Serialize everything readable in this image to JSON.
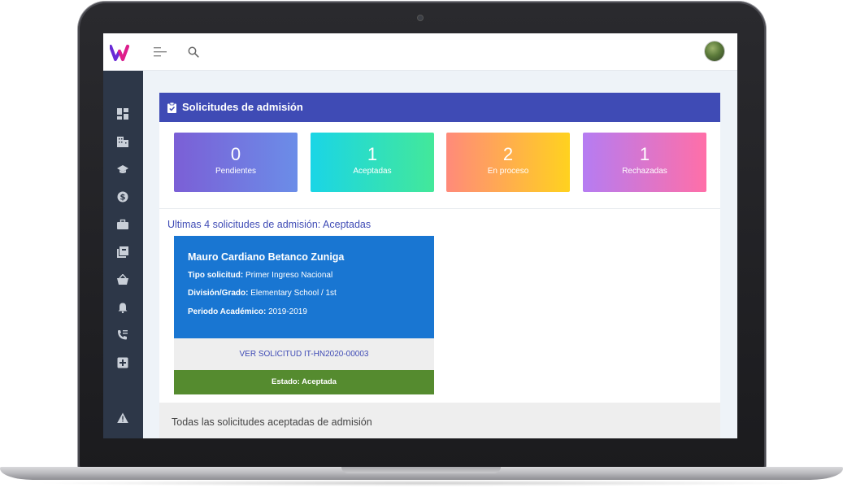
{
  "header": {
    "icons": [
      "logo-icon",
      "menu-icon",
      "search-icon",
      "avatar"
    ]
  },
  "sidebar": {
    "items": [
      {
        "icon": "dashboard-icon"
      },
      {
        "icon": "building-icon"
      },
      {
        "icon": "graduation-cap-icon"
      },
      {
        "icon": "dollar-icon"
      },
      {
        "icon": "briefcase-icon"
      },
      {
        "icon": "library-icon"
      },
      {
        "icon": "basket-icon"
      },
      {
        "icon": "bell-icon"
      },
      {
        "icon": "phone-list-icon"
      },
      {
        "icon": "medical-box-icon"
      },
      {
        "icon": "warning-icon"
      }
    ]
  },
  "panel": {
    "title": "Solicitudes de admisión"
  },
  "stats": [
    {
      "value": "0",
      "label": "Pendientes",
      "gradient": [
        "#7b5fd6",
        "#6b8de8"
      ]
    },
    {
      "value": "1",
      "label": "Aceptadas",
      "gradient": [
        "#1ad5e6",
        "#43e89a"
      ]
    },
    {
      "value": "2",
      "label": "En proceso",
      "gradient": [
        "#ff8a7a",
        "#ffd21f"
      ]
    },
    {
      "value": "1",
      "label": "Rechazadas",
      "gradient": [
        "#b57cf2",
        "#ff6fa8"
      ]
    }
  ],
  "recent": {
    "title": "Ultimas 4 solicitudes de admisión: Aceptadas",
    "card": {
      "name": "Mauro Cardiano Betanco Zuniga",
      "tipo_label": "Tipo solicitud:",
      "tipo_value": "Primer Ingreso Nacional",
      "division_label": "División/Grado:",
      "division_value": "Elementary School / 1st",
      "periodo_label": "Periodo Académico:",
      "periodo_value": "2019-2019",
      "link": "VER SOLICITUD IT-HN2020-00003",
      "status": "Estado: Aceptada"
    }
  },
  "all_section": {
    "title": "Todas las solicitudes aceptadas de admisión"
  },
  "colors": {
    "accent": "#3f4bb5",
    "sidebar": "#2d3748",
    "card_blue": "#1976d2",
    "status_green": "#558b2f",
    "logo": "#c21fa0"
  }
}
